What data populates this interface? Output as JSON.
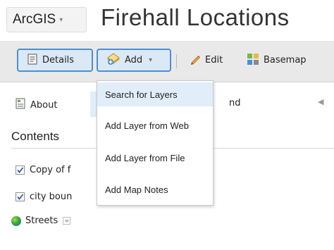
{
  "header": {
    "brand": "ArcGIS",
    "brand_caret": "▾",
    "map_title": "Firehall Locations"
  },
  "toolbar": {
    "details_label": "Details",
    "add_label": "Add",
    "add_caret": "▾",
    "edit_label": "Edit",
    "basemap_label": "Basemap"
  },
  "tabs": {
    "about_label": "About",
    "legend_label_partial": "nd",
    "scroll_left": "◀"
  },
  "contents": {
    "heading": "Contents",
    "layers": [
      {
        "label": "Copy of f",
        "checked": true
      },
      {
        "label": "city boun",
        "checked": true
      },
      {
        "label": "Streets",
        "icon": "globe-icon"
      }
    ]
  },
  "add_menu": {
    "items": [
      {
        "label": "Search for Layers",
        "highlighted": true
      },
      {
        "label": "Add Layer from Web"
      },
      {
        "label": "Add Layer from File"
      },
      {
        "label": "Add Map Notes"
      }
    ]
  },
  "colors": {
    "accent": "#4a8fd6",
    "active_bg": "#dbe9f7",
    "toolbar_bg": "#e9e9e9",
    "menu_highlight": "#e1edf9"
  }
}
